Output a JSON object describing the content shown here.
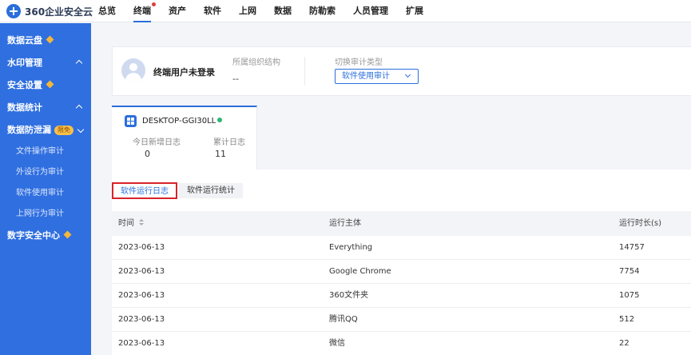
{
  "app": {
    "name": "360企业安全云"
  },
  "nav": [
    {
      "label": "总览"
    },
    {
      "label": "终端",
      "active": true,
      "dot": true
    },
    {
      "label": "资产"
    },
    {
      "label": "软件"
    },
    {
      "label": "上网"
    },
    {
      "label": "数据"
    },
    {
      "label": "防勒索"
    },
    {
      "label": "人员管理"
    },
    {
      "label": "扩展"
    }
  ],
  "sidebar": {
    "data_cloud": "数据云盘",
    "watermark": "水印管理",
    "security_settings": "安全设置",
    "data_stats": "数据统计",
    "dlp": "数据防泄漏",
    "dlp_badge": "限免",
    "sub_items": [
      "文件操作审计",
      "外设行为审计",
      "软件使用审计",
      "上网行为审计"
    ],
    "data_security_center": "数字安全中心"
  },
  "user": {
    "name": "终端用户未登录",
    "org_label": "所属组织结构",
    "org_value": "--",
    "audit_type_label": "切换审计类型",
    "audit_type_value": "软件使用审计"
  },
  "device": {
    "name": "DESKTOP-GGI30LL",
    "today_label": "今日新增日志",
    "today_value": "0",
    "total_label": "累计日志",
    "total_value": "11"
  },
  "tabs": {
    "run_log": "软件运行日志",
    "run_stats": "软件运行统计"
  },
  "table": {
    "headers": {
      "time": "时间",
      "subject": "运行主体",
      "duration": "运行时长(s)"
    },
    "rows": [
      {
        "time": "2023-06-13",
        "subject": "Everything",
        "duration": "14757"
      },
      {
        "time": "2023-06-13",
        "subject": "Google Chrome",
        "duration": "7754"
      },
      {
        "time": "2023-06-13",
        "subject": "360文件夹",
        "duration": "1075"
      },
      {
        "time": "2023-06-13",
        "subject": "腾讯QQ",
        "duration": "512"
      },
      {
        "time": "2023-06-13",
        "subject": "微信",
        "duration": "22"
      }
    ]
  }
}
